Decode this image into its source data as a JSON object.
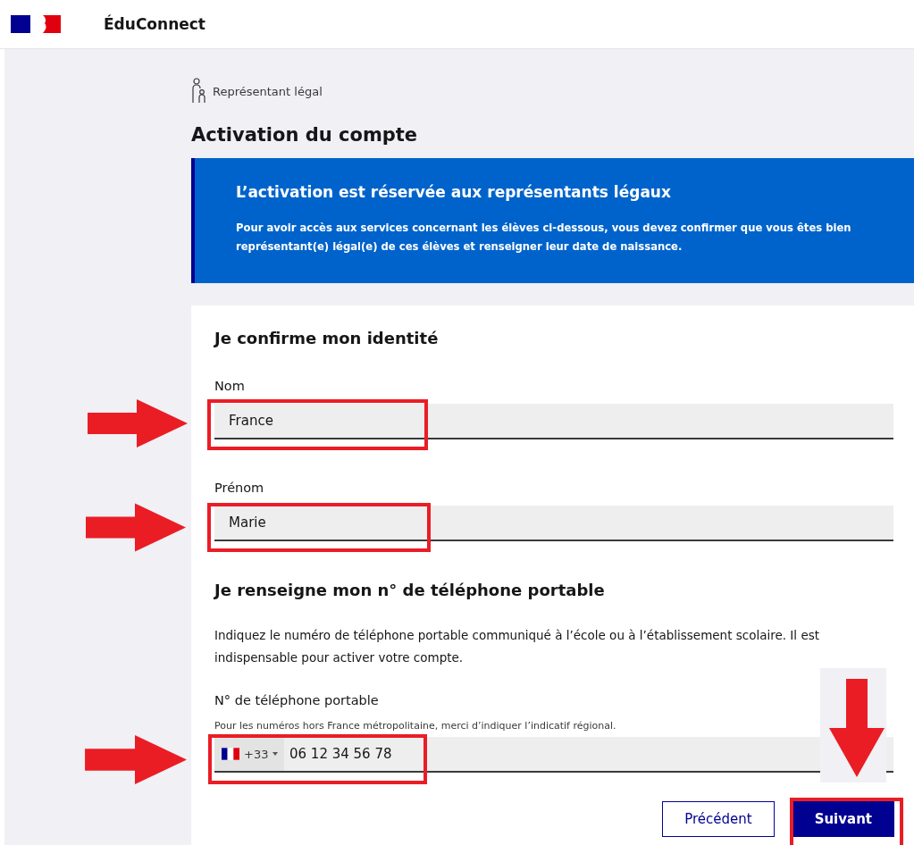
{
  "header": {
    "title": "ÉduConnect"
  },
  "breadcrumb": {
    "label": "Représentant légal"
  },
  "page_title": "Activation du compte",
  "notice": {
    "title": "L’activation est réservée aux représentants légaux",
    "text": "Pour avoir accès aux services concernant les élèves ci-dessous, vous devez confirmer que vous êtes bien représentant(e) légal(e) de ces élèves et renseigner leur date de naissance."
  },
  "identity": {
    "heading": "Je confirme mon identité",
    "fields": [
      {
        "label": "Nom",
        "value": "France"
      },
      {
        "label": "Prénom",
        "value": "Marie"
      }
    ]
  },
  "phone": {
    "heading": "Je renseigne mon n° de téléphone portable",
    "text": "Indiquez le numéro de téléphone portable communiqué à l’école ou à l’établissement scolaire. Il est indispensable pour activer votre compte.",
    "label": "N° de téléphone portable",
    "hint": "Pour les numéros hors France métropolitaine, merci d’indiquer l’indicatif régional.",
    "country_code": "+33",
    "value": "06 12 34 56 78"
  },
  "buttons": [
    {
      "label": "Précédent",
      "kind": "secondary"
    },
    {
      "label": "Suivant",
      "kind": "primary"
    }
  ],
  "annotations": [
    {
      "kind": "right-arrow"
    },
    {
      "kind": "right-arrow"
    },
    {
      "kind": "right-arrow"
    },
    {
      "kind": "down-arrow"
    },
    {
      "kind": "frame"
    },
    {
      "kind": "frame"
    },
    {
      "kind": "frame"
    },
    {
      "kind": "frame"
    }
  ]
}
